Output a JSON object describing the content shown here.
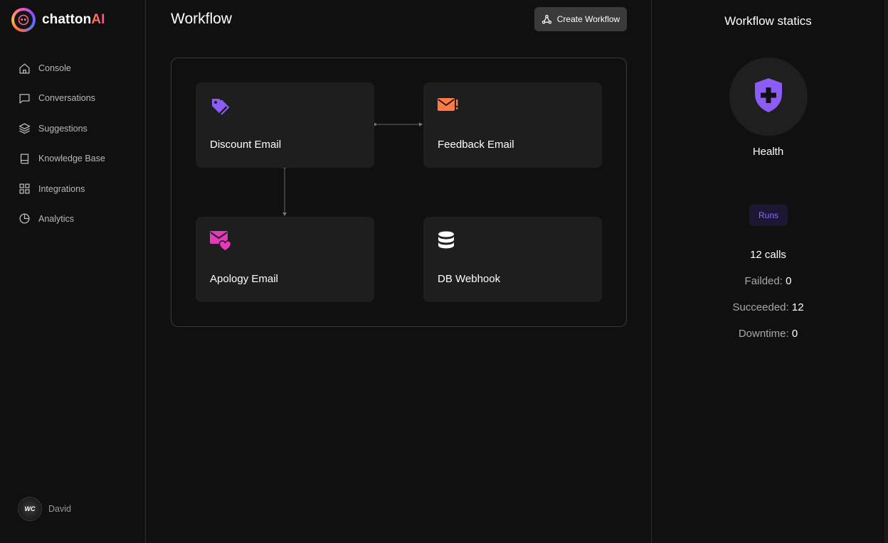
{
  "brand": {
    "name_prefix": "chatton",
    "name_suffix": "AI",
    "logo_icon": "chatton-logo-icon"
  },
  "sidebar": {
    "items": [
      {
        "label": "Console",
        "icon": "home-icon"
      },
      {
        "label": "Conversations",
        "icon": "chat-bubble-icon"
      },
      {
        "label": "Suggestions",
        "icon": "layers-icon"
      },
      {
        "label": "Knowledge Base",
        "icon": "book-icon"
      },
      {
        "label": "Integrations",
        "icon": "grid-icon"
      },
      {
        "label": "Analytics",
        "icon": "pie-chart-icon"
      }
    ],
    "user": {
      "name": "David",
      "avatar_initials": "WC"
    }
  },
  "main": {
    "title": "Workflow",
    "create_button_label": "Create Workflow",
    "nodes": [
      {
        "label": "Discount Email",
        "icon": "tag-icon",
        "color": "#8b5cf6"
      },
      {
        "label": "Feedback Email",
        "icon": "mail-alert-icon",
        "color": "#ff7a45"
      },
      {
        "label": "Apology Email",
        "icon": "mail-heart-icon",
        "color": "#e23ab8"
      },
      {
        "label": "DB Webhook",
        "icon": "database-icon",
        "color": "#ffffff"
      }
    ]
  },
  "stats": {
    "title": "Workflow statics",
    "health_label": "Health",
    "health_icon": "shield-plus-icon",
    "runs_badge": "Runs",
    "calls": "12 calls",
    "failed_label": "Failded:",
    "failed_value": "0",
    "succeeded_label": "Succeeded:",
    "succeeded_value": "12",
    "downtime_label": "Downtime:",
    "downtime_value": "0"
  },
  "colors": {
    "background": "#101010",
    "card": "#1e1e1e",
    "accent_purple": "#8b5cf6",
    "accent_orange": "#ff7a45",
    "accent_pink": "#e23ab8"
  }
}
